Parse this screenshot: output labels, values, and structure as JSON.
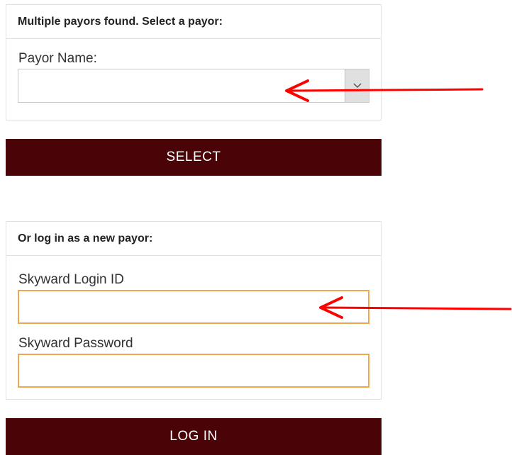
{
  "payor_panel": {
    "header": "Multiple payors found. Select a payor:",
    "payor_name_label": "Payor Name:",
    "payor_name_value": "",
    "arrow_glyph": "⌄"
  },
  "select_button": {
    "label": "SELECT"
  },
  "login_panel": {
    "header": "Or log in as a new payor:",
    "login_id_label": "Skyward Login ID",
    "login_id_value": "",
    "password_label": "Skyward Password",
    "password_value": ""
  },
  "login_button": {
    "label": "LOG IN"
  },
  "colors": {
    "button_bg": "#4a0408",
    "input_border": "#f0a64a",
    "annotation_arrow": "#ff0000"
  }
}
